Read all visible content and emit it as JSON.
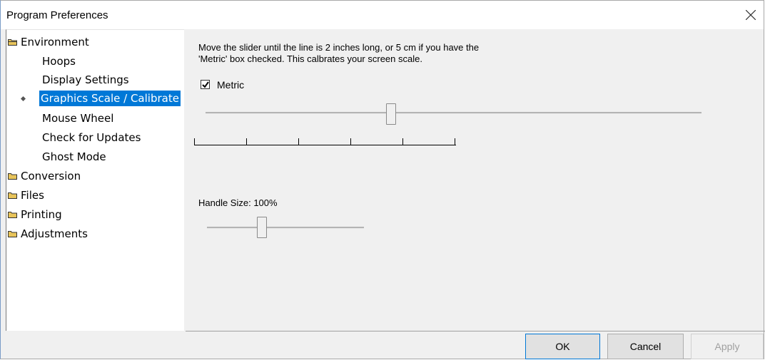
{
  "window": {
    "title": "Program Preferences"
  },
  "tree": {
    "items": [
      {
        "label": "Environment",
        "type": "folder"
      },
      {
        "label": "Hoops",
        "type": "child"
      },
      {
        "label": "Display Settings",
        "type": "child"
      },
      {
        "label": "Graphics Scale / Calibrate",
        "type": "child",
        "selected": true
      },
      {
        "label": "Mouse Wheel",
        "type": "child"
      },
      {
        "label": "Check for Updates",
        "type": "child"
      },
      {
        "label": "Ghost Mode",
        "type": "child"
      },
      {
        "label": "Conversion",
        "type": "folder"
      },
      {
        "label": "Files",
        "type": "folder"
      },
      {
        "label": "Printing",
        "type": "folder"
      },
      {
        "label": "Adjustments",
        "type": "folder"
      }
    ]
  },
  "calibrate": {
    "description_line1": "Move the slider until the line is 2 inches long, or 5 cm if you have the",
    "description_line2": "'Metric' box checked. This calbrates your screen scale.",
    "metric_label": "Metric",
    "metric_checked": true,
    "scale_slider_value": 0.37
  },
  "handle": {
    "label": "Handle Size: 100%",
    "slider_value": 0.37
  },
  "buttons": {
    "ok": "OK",
    "cancel": "Cancel",
    "apply": "Apply"
  },
  "colors": {
    "selection": "#0078d7",
    "folder": "#e8c45a"
  }
}
